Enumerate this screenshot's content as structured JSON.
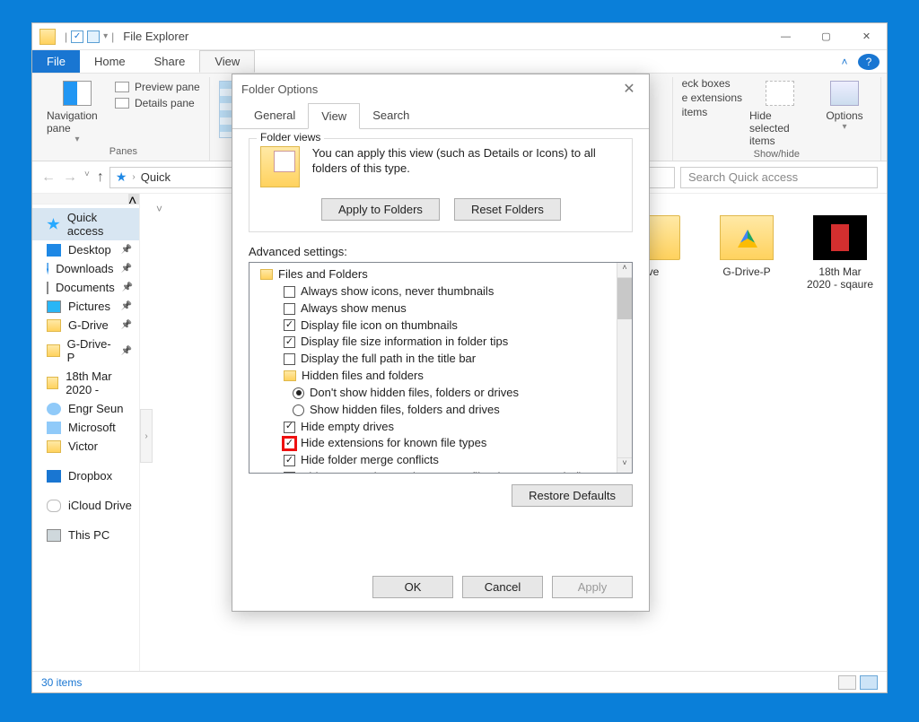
{
  "window": {
    "title": "File Explorer",
    "controls": {
      "min": "—",
      "max": "▢",
      "close": "✕"
    }
  },
  "ribbon": {
    "tabs": [
      "File",
      "Home",
      "Share",
      "View"
    ],
    "active_tab": "View",
    "panes_group": {
      "nav_pane": "Navigation pane",
      "preview_pane": "Preview pane",
      "details_pane": "Details pane",
      "label": "Panes"
    },
    "showhide_group": {
      "check_boxes": "eck boxes",
      "extensions": "e extensions",
      "items_opt": "items",
      "hide_selected": "Hide selected items",
      "options": "Options",
      "label": "Show/hide"
    }
  },
  "addressbar": {
    "crumb": "Quick",
    "search_placeholder": "Search Quick access"
  },
  "nav_items": [
    {
      "icon": "ni-star",
      "label": "Quick access",
      "pin": false,
      "selected": true
    },
    {
      "icon": "ni-desk",
      "label": "Desktop",
      "pin": true
    },
    {
      "icon": "ni-down",
      "label": "Downloads",
      "pin": true
    },
    {
      "icon": "ni-doc",
      "label": "Documents",
      "pin": true
    },
    {
      "icon": "ni-pic",
      "label": "Pictures",
      "pin": true
    },
    {
      "icon": "ni-folder",
      "label": "G-Drive",
      "pin": true
    },
    {
      "icon": "ni-folder",
      "label": "G-Drive-P",
      "pin": true
    },
    {
      "icon": "ni-folder",
      "label": "18th Mar 2020 -",
      "pin": false
    },
    {
      "icon": "ni-user",
      "label": "Engr Seun",
      "pin": false
    },
    {
      "icon": "ni-microsoft",
      "label": "Microsoft",
      "pin": false
    },
    {
      "icon": "ni-folder",
      "label": "Victor",
      "pin": false
    },
    {
      "icon": "ni-dropbox",
      "label": "Dropbox",
      "pin": false,
      "spaced": true
    },
    {
      "icon": "ni-icloud",
      "label": "iCloud Drive",
      "pin": false,
      "spaced": true
    },
    {
      "icon": "ni-pc",
      "label": "This PC",
      "pin": false,
      "spaced": true
    }
  ],
  "content_items": [
    {
      "icon": "gi-folder",
      "label": "ve"
    },
    {
      "icon": "gi-gd",
      "label": "G-Drive-P"
    },
    {
      "icon": "gi-square",
      "label": "18th Mar 2020 - sqaure"
    }
  ],
  "statusbar": {
    "text": "30 items"
  },
  "dialog": {
    "title": "Folder Options",
    "tabs": [
      "General",
      "View",
      "Search"
    ],
    "active_tab": "View",
    "folder_views": {
      "group_label": "Folder views",
      "desc": "You can apply this view (such as Details or Icons) to all folders of this type.",
      "apply": "Apply to Folders",
      "reset": "Reset Folders"
    },
    "advanced_label": "Advanced settings:",
    "advanced_items": [
      {
        "kind": "folder",
        "text": "Files and Folders"
      },
      {
        "kind": "check",
        "checked": false,
        "text": "Always show icons, never thumbnails",
        "indent": 1
      },
      {
        "kind": "check",
        "checked": false,
        "text": "Always show menus",
        "indent": 1
      },
      {
        "kind": "check",
        "checked": true,
        "text": "Display file icon on thumbnails",
        "indent": 1
      },
      {
        "kind": "check",
        "checked": true,
        "text": "Display file size information in folder tips",
        "indent": 1
      },
      {
        "kind": "check",
        "checked": false,
        "text": "Display the full path in the title bar",
        "indent": 1
      },
      {
        "kind": "folder",
        "text": "Hidden files and folders",
        "indent": 1
      },
      {
        "kind": "radio",
        "sel": true,
        "text": "Don't show hidden files, folders or drives",
        "indent": 2
      },
      {
        "kind": "radio",
        "sel": false,
        "text": "Show hidden files, folders and drives",
        "indent": 2
      },
      {
        "kind": "check",
        "checked": true,
        "text": "Hide empty drives",
        "indent": 1
      },
      {
        "kind": "check",
        "checked": true,
        "highlight": true,
        "text": "Hide extensions for known file types",
        "indent": 1
      },
      {
        "kind": "check",
        "checked": true,
        "text": "Hide folder merge conflicts",
        "indent": 1
      },
      {
        "kind": "check",
        "checked": true,
        "text": "Hide protected operating system files (Recommended)",
        "indent": 1
      }
    ],
    "restore": "Restore Defaults",
    "buttons": {
      "ok": "OK",
      "cancel": "Cancel",
      "apply": "Apply"
    }
  }
}
